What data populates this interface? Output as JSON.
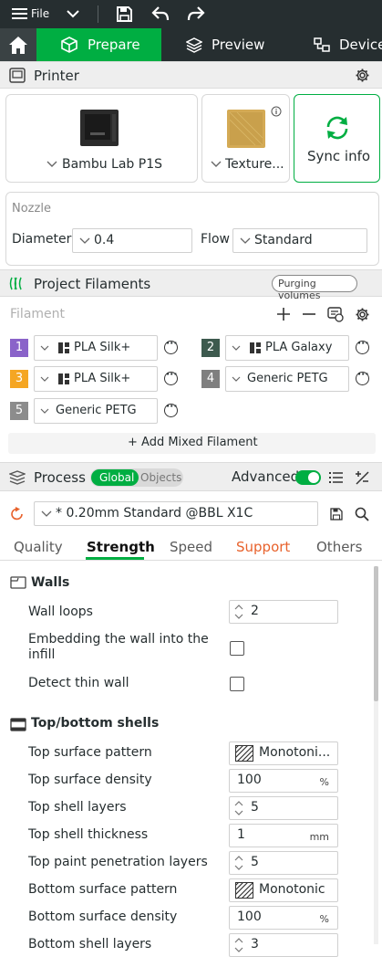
{
  "titlebar": {
    "file_label": "File"
  },
  "tabs": {
    "prepare": "Prepare",
    "preview": "Preview",
    "device": "Device"
  },
  "printer": {
    "section_title": "Printer",
    "printer_name": "Bambu Lab P1S",
    "plate_name": "Texture...",
    "sync_label": "Sync info",
    "nozzle_label": "Nozzle",
    "diameter_label": "Diameter",
    "diameter_value": "0.4",
    "flow_label": "Flow",
    "flow_value": "Standard"
  },
  "filaments": {
    "section_title": "Project Filaments",
    "purging_label": "Purging volumes",
    "filament_label": "Filament",
    "items": [
      {
        "num": "1",
        "name": "PLA Silk+",
        "color": "#8a63c9"
      },
      {
        "num": "2",
        "name": "PLA Galaxy",
        "color": "#3d5a4e"
      },
      {
        "num": "3",
        "name": "PLA Silk+",
        "color": "#f5a623"
      },
      {
        "num": "4",
        "name": "Generic PETG",
        "color": "#7f7f7f"
      },
      {
        "num": "5",
        "name": "Generic PETG",
        "color": "#8c8c8c"
      }
    ],
    "add_mixed_label": "+ Add Mixed Filament"
  },
  "process": {
    "section_title": "Process",
    "global_label": "Global",
    "objects_label": "Objects",
    "advanced_label": "Advanced",
    "preset_name": "* 0.20mm Standard @BBL X1C",
    "tabs": [
      "Quality",
      "Strength",
      "Speed",
      "Support",
      "Others"
    ],
    "active_tab": "Strength"
  },
  "walls": {
    "title": "Walls",
    "wall_loops_label": "Wall loops",
    "wall_loops_value": "2",
    "embed_label": "Embedding the wall into the infill",
    "detect_label": "Detect thin wall"
  },
  "shells": {
    "title": "Top/bottom shells",
    "rows": [
      {
        "label": "Top surface pattern",
        "value": "Monotoni...",
        "kind": "pattern"
      },
      {
        "label": "Top surface density",
        "value": "100",
        "unit": "%",
        "kind": "unit"
      },
      {
        "label": "Top shell layers",
        "value": "5",
        "kind": "spin"
      },
      {
        "label": "Top shell thickness",
        "value": "1",
        "unit": "mm",
        "kind": "unit"
      },
      {
        "label": "Top paint penetration layers",
        "value": "5",
        "kind": "spin"
      },
      {
        "label": "Bottom surface pattern",
        "value": "Monotonic",
        "kind": "pattern"
      },
      {
        "label": "Bottom surface density",
        "value": "100",
        "unit": "%",
        "kind": "unit"
      },
      {
        "label": "Bottom shell layers",
        "value": "3",
        "kind": "spin"
      }
    ]
  },
  "colors": {
    "accent": "#00ae42",
    "support": "#e8622c"
  }
}
